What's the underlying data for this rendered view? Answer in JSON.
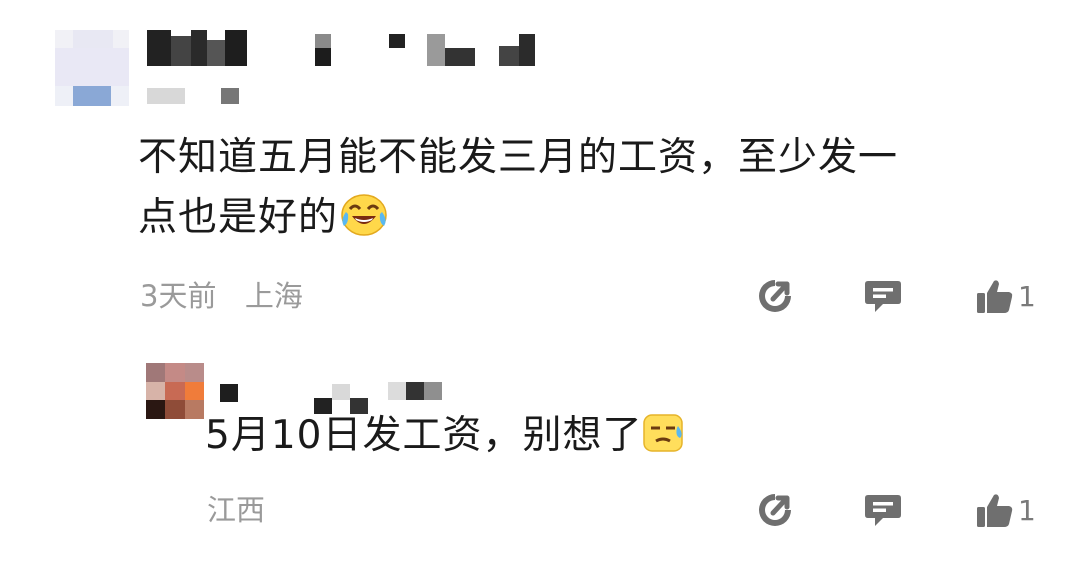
{
  "comments": [
    {
      "text_line1": "不知道五月能不能发三月的工资，至少发一",
      "text_line2": "点也是好的",
      "emoji": "laughing-tears-emoji",
      "time": "3天前",
      "location": "上海",
      "likes": "1"
    },
    {
      "text": "5月10日发工资，别想了",
      "emoji": "sweat-emoji",
      "location": "江西",
      "likes": "1"
    }
  ],
  "icons": {
    "share": "share-icon",
    "reply": "reply-icon",
    "like": "thumbs-up-icon"
  },
  "colors": {
    "text": "#1a1a1a",
    "meta": "#9a9a9a",
    "icon": "#6f6f6f"
  }
}
